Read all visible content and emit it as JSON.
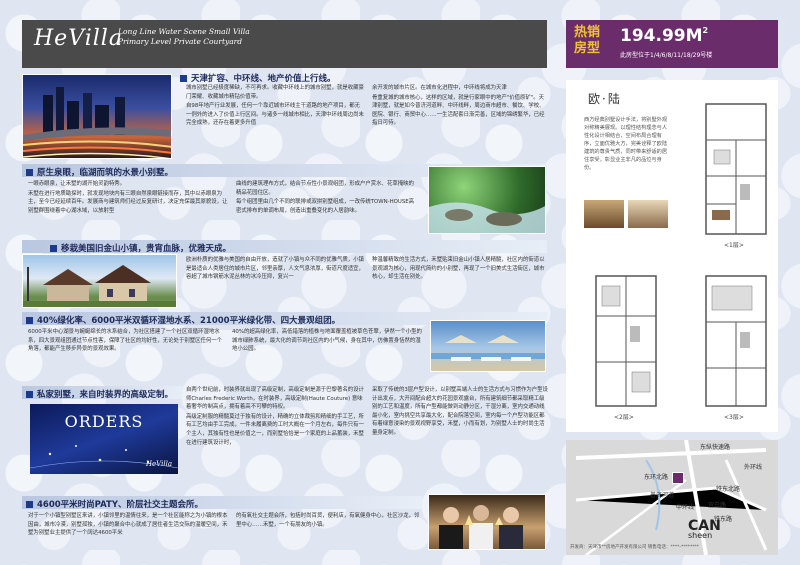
{
  "brand": {
    "name": "HeVilla",
    "tagline": "Long Line Water Scene Small Villa Primary Level Private Courtyard"
  },
  "sections": {
    "s1": {
      "title": "天津扩容、中环线、地产价值上行线。",
      "col1": [
        "城市别墅已经极度稀缺，不可再求。收藏中环线上的城市别墅，就是收藏豪门荣耀、收藏城市精钻价值带。",
        "自98年地产行业发展，任何一个靠近城市环线主干道路的地产项目，都无一例外的进入了价值上行区间。与诸多一线城市相比，天津中环线周边尚未完全成熟，还存在着更多升值"
      ],
      "col2": [
        "余开发的城市片区。在城市化进程中，中环线将成为天津"
      ],
      "col2b": "骨重复城的城市核心，这样的区域，就是行家眼中的地产\"价值原矿\"。天津别墅，就是如今普济河道畔、中环线畔，周边商市超市、餐饮、学校、医院、银行、商贸中心……一生活配套日渐完善，区域的锦绣繁华，已经指日可待。"
    },
    "s2": {
      "title": "原生泉眼，临湖而筑的水景小别墅。",
      "col1": [
        "一眼赤眼泉，让禾墅的湖开始灵韵特秀。",
        "禾墅在进行地质勘探时，就发现地块内有三眼自然泉眼链接而存，其中以赤眼泉为主，至今已经延续百年。发展商与建筑师们经过反复研讨，决定充保最其原貌设，让别墅群围绕着中心湖水域，以放射型"
      ],
      "col2": [
        "曲线的建筑理布方式，结合节点性小景观组团，形成户户赏水、花草掩映的精品花园住区。",
        "每个组团里由几个不同的联排或双拼别墅组成，一改传统TOWN-HOUSE高密式排布的单调布局，创造出重叠变化的人居韵味。"
      ]
    },
    "s3": {
      "title": "移栽美国旧金山小镇，贵宵血脉，优雅天成。",
      "col1": [
        "欧洲朴质的优雅与美国的自由开放，造就了小镇与众不同的优雅气质，小镇是最适合人类居住的城市片区，邻里亲厚，人文气息浓厚，街道尺度适宜，容超了城市钢筋水泥丛林的冰冷压抑，复兴一"
      ],
      "col2": [
        "种温馨精致的生活方式，禾墅贴束旧金山小镇人居精髓，社区内的街道以景观湖为核心，用现代简约的小别墅，再现了一个旧美式生活街区，城市核心，却生活在别处。"
      ]
    },
    "s4": {
      "title": "40%绿化率、6000平米双循环湿地水系、21000平米绿化带、四大景观组团。",
      "col1": [
        "6000平米中心湖景与蜿蜒绵长的水系结合，为社区搭建了一个社区双循环湿地水系，四大景观组团通过节点性客，保障了社区的均好性，无论处于别墅区任何一个角落，都能产生移步异景的景观效果。"
      ],
      "col2": [
        "40%的超高绿化率，高低错落的植株与地面覆盖植被草色苍翠，伊然一个小型的城市绿肺系统，最大化的调节到社区内的小气候，身在其中，仿佛置身恬然的湿地小公园。"
      ]
    },
    "s5": {
      "title": "私家别墅，来自时装界的高级定制。",
      "orders": "ORDERS",
      "orders_brand": "HeVilla",
      "col1": [
        "自两个世纪前，时装界就出现了高级定制，高级定制是源于巴黎著名的设计师Charles Frederic Worth，在时装界，高级定制(Haute Couture) 意味着奢华的制高点，拥有着高不可攀的特权。",
        "高级定制服的精髓莫过于独有的设计，精确的立体裁剪和精细的手工艺，所有工艺均由手工完成，一件未履离费的工时大概在一个月左右，每件只有一个主人，其独有性也是价值之一，而别墅恰恰是一个家庭的上品蓄装，禾墅在进行建筑设计时，"
      ],
      "col2": [
        "采取了传统的3层户型设计，以别墅高端人士的生活方式与习惯作为户型设计出发点，大开间配合超大的花园景观露台，所有建筑细节都采取精工级别的工艺和温度，所有户型都能做到动静分区，干湿分离，室内交通动线最小化，室内挑空共享最大化，配合院落空间，室内每一个户型功能区都有着绿意浸染的景观视野享受，禾墅，小而有划，为别墅人士的时尚生活量身定制。"
      ]
    },
    "s6": {
      "title": "4600平米时尚PATY、阶层社交主题会所。",
      "col1": [
        "对于一个小镇型别墅区来讲，小镇邻里的温情往来，是一个社区能称之为小镇的根本因由，城市冷漠，别墅孤独，小镇的聚合中心就成了居住者生活交际的温暖空间，禾墅为别墅业主提供了一个阔达4600平米"
      ],
      "col2": [
        "的有氧社交主题会所，包括时尚百货，便利店，有氧健身中心，社区沙龙，邻里中心……禾墅，一个有朋友的小镇。"
      ]
    }
  },
  "sales": {
    "label": "热销房型",
    "area": "194.99M",
    "area_sup": "2",
    "note": "此房型位于1/4/6/8/11/18/29号楼"
  },
  "plan": {
    "style_name": "欧·陆",
    "description": "西方经典别墅设计手法，将别墅外观对称精美展现。以理性结构理念与人性化设计相结合，空间布局合理有序，立面优雅大方，完美诠释了欧陆建筑的尊贵气质，同时带来舒适的居住享受，彰显业主非凡的品位与身份。",
    "floors": [
      "<1层>",
      "<2层>",
      "<3层>"
    ]
  },
  "map": {
    "labels": {
      "road1": "东纵快速路",
      "road2": "东环北路",
      "road3": "铁东北路",
      "road4": "外环线",
      "road5": "中环线",
      "road6": "铁东路",
      "road7": "宜白路",
      "road8": "普济河道",
      "note": "开发商：天津市**房地产开发有限公司  销售电话：****-********"
    },
    "logo": "CAN",
    "logo_sub": "sheen"
  }
}
